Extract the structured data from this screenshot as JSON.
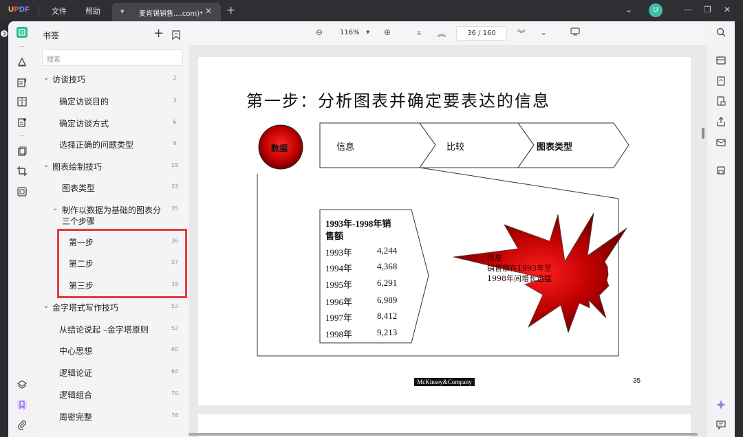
{
  "app": {
    "logo": "UPDF",
    "menu": [
      "文件",
      "帮助"
    ]
  },
  "tab": {
    "title": "麦肯锡销售....com)*"
  },
  "user": {
    "avatar_letter": "U"
  },
  "sidebar": {
    "title": "书签",
    "search_placeholder": "搜索",
    "items": [
      {
        "label": "访谈技巧",
        "page": "2",
        "level": 0,
        "expanded": true
      },
      {
        "label": "确定访谈目的",
        "page": "3",
        "level": 1
      },
      {
        "label": "确定访谈方式",
        "page": "6",
        "level": 1
      },
      {
        "label": "选择正确的问题类型",
        "page": "9",
        "level": 1
      },
      {
        "label": "图表绘制技巧",
        "page": "29",
        "level": 0,
        "expanded": true
      },
      {
        "label": "图表类型",
        "page": "33",
        "level": 2
      },
      {
        "label": "制作以数据为基础的图表分",
        "label2": "三个步骤",
        "page": "35",
        "level": 1,
        "expanded": true
      },
      {
        "label": "第一步",
        "page": "36",
        "level": 3
      },
      {
        "label": "第二步",
        "page": "37",
        "level": 3
      },
      {
        "label": "第三步",
        "page": "39",
        "level": 3
      },
      {
        "label": "金字塔式写作技巧",
        "page": "52",
        "level": 0,
        "expanded": true
      },
      {
        "label": "从结论说起 –金字塔原则",
        "page": "52",
        "level": 1
      },
      {
        "label": "中心思想",
        "page": "60",
        "level": 1
      },
      {
        "label": "逻辑论证",
        "page": "64",
        "level": 1
      },
      {
        "label": "逻辑组合",
        "page": "70",
        "level": 1
      },
      {
        "label": "周密完整",
        "page": "78",
        "level": 1
      }
    ]
  },
  "toolbar": {
    "zoom": "116%",
    "current_page": "36",
    "total_pages": "160"
  },
  "slide": {
    "title": "第一步：分析图表并确定要表达的信息",
    "circle_label": "数据",
    "chevrons": [
      "信息",
      "比较",
      "图表类型"
    ],
    "table_title_1": "1993年-1998年销",
    "table_title_2": "售额",
    "rows": [
      {
        "year": "1993年",
        "value": "4,244"
      },
      {
        "year": "1994年",
        "value": "4,368"
      },
      {
        "year": "1995年",
        "value": "6,291"
      },
      {
        "year": "1996年",
        "value": "6,989"
      },
      {
        "year": "1997年",
        "value": "8,412"
      },
      {
        "year": "1998年",
        "value": "9,213"
      }
    ],
    "star_lines": [
      "信息",
      "销售额在1993年至",
      "1998年间增长迅猛"
    ],
    "footer_logo": "McKinsey&Company",
    "page_number": "35"
  },
  "colors": {
    "accent": "#2dbd8f",
    "highlight": "#e23b3b",
    "star_red": "#c00000"
  }
}
